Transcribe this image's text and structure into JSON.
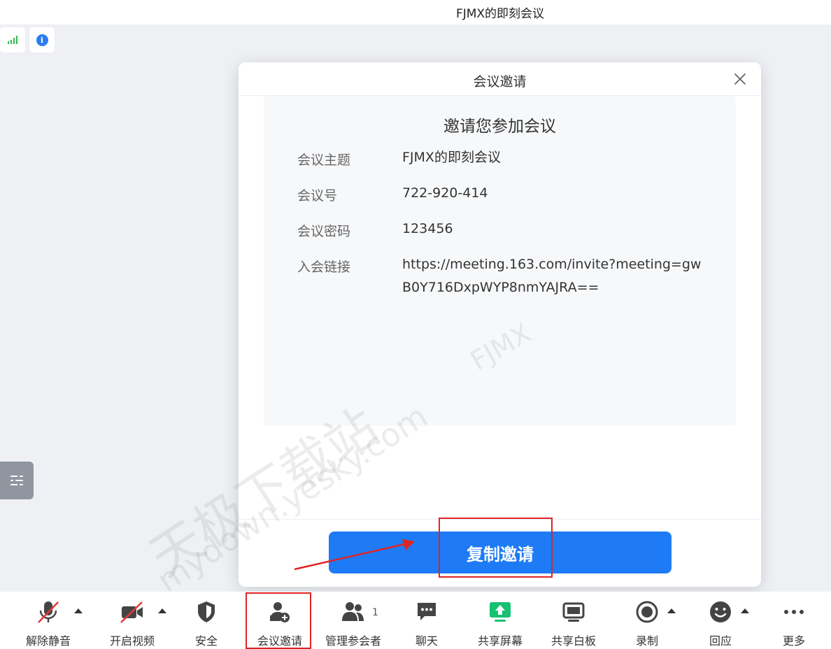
{
  "window": {
    "title": "FJMX的即刻会议"
  },
  "status": {
    "signal_icon": "signal-bars-icon",
    "info_icon": "info-icon",
    "info_glyph": "i"
  },
  "dialog": {
    "title": "会议邀请",
    "heading": "邀请您参加会议",
    "rows": [
      {
        "label": "会议主题",
        "value": "FJMX的即刻会议"
      },
      {
        "label": "会议号",
        "value": "722-920-414"
      },
      {
        "label": "会议密码",
        "value": "123456"
      },
      {
        "label": "入会链接",
        "value": "https://meeting.163.com/invite?meeting=gwB0Y716DxpWYP8nmYAJRA=="
      }
    ],
    "copy_button": "复制邀请"
  },
  "watermarks": {
    "cn": "天极下载站",
    "url": "mydown.yesky.com",
    "brand": "FJMX"
  },
  "toolbar": {
    "items": [
      {
        "label": "解除静音",
        "icon": "mic-muted-icon"
      },
      {
        "label": "开启视频",
        "icon": "video-off-icon"
      },
      {
        "label": "安全",
        "icon": "shield-icon"
      },
      {
        "label": "会议邀请",
        "icon": "add-user-icon"
      },
      {
        "label": "管理参会者",
        "icon": "participants-icon",
        "count": "1"
      },
      {
        "label": "聊天",
        "icon": "chat-icon"
      },
      {
        "label": "共享屏幕",
        "icon": "share-screen-icon"
      },
      {
        "label": "共享白板",
        "icon": "whiteboard-icon"
      },
      {
        "label": "录制",
        "icon": "record-icon"
      },
      {
        "label": "回应",
        "icon": "smile-icon"
      },
      {
        "label": "更多",
        "icon": "more-icon"
      }
    ]
  },
  "colors": {
    "accent": "#1e7bf5",
    "highlight": "#e02424",
    "share_green": "#16c172"
  }
}
